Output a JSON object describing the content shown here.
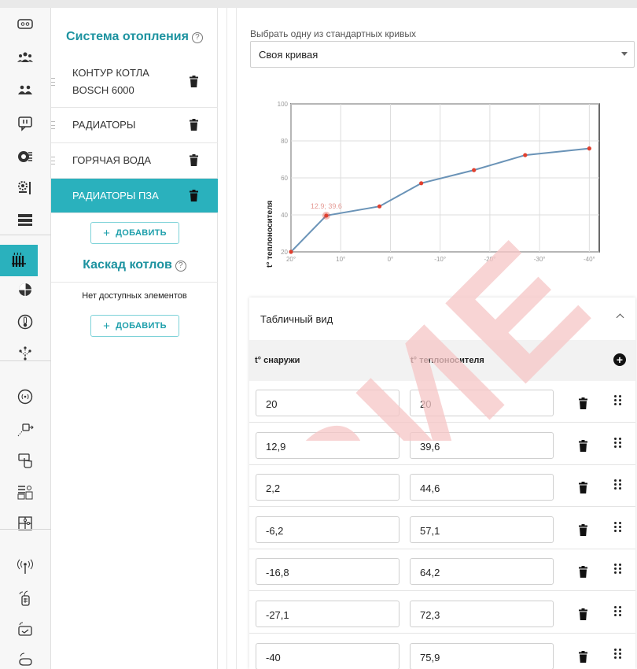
{
  "rail": {
    "icons": [
      "counter-icon",
      "users-group-icon",
      "users-icon",
      "chat-alert-icon",
      "burner-icon",
      "gear-settings-icon",
      "server-icon",
      "radiator-icon",
      "globe-icon",
      "thermometer-icon",
      "network-icon",
      "signal-icon",
      "sensor-icon",
      "touch-icon",
      "panel-icon",
      "puzzle-icon",
      "antenna-icon",
      "tag-icon",
      "remote-icon",
      "hand-icon"
    ]
  },
  "tree": {
    "heating_title": "Система отопления",
    "heating_help": "?",
    "items": [
      {
        "label_line1": "КОНТУР КОТЛА",
        "label_line2": "BOSCH 6000"
      },
      {
        "label_line1": "РАДИАТОРЫ",
        "label_line2": ""
      },
      {
        "label_line1": "ГОРЯЧАЯ ВОДА",
        "label_line2": ""
      },
      {
        "label_line1": "РАДИАТОРЫ ПЗА",
        "label_line2": ""
      }
    ],
    "add_label": "ДОБАВИТЬ",
    "cascade_title": "Каскад котлов",
    "cascade_help": "?",
    "cascade_empty": "Нет доступных элементов",
    "add_label_2": "ДОБАВИТЬ"
  },
  "curve": {
    "select_label": "Выбрать одну из стандартных кривых",
    "select_value": "Своя кривая"
  },
  "chart_data": {
    "type": "line",
    "ylabel": "t° теплоносителя",
    "ylim": [
      20,
      100
    ],
    "xlim": [
      20,
      -42
    ],
    "y_ticks": [
      "20",
      "40",
      "60",
      "80",
      "100"
    ],
    "x_ticks": [
      "20°",
      "10°",
      "0°",
      "-10°",
      "-20°",
      "-30°",
      "-40°"
    ],
    "x_tick_values": [
      20,
      10,
      0,
      -10,
      -20,
      -30,
      -40
    ],
    "y_tick_values": [
      20,
      40,
      60,
      80,
      100
    ],
    "x": [
      20,
      12.9,
      2.2,
      -6.2,
      -16.8,
      -27.1,
      -40
    ],
    "y": [
      20,
      39.6,
      44.6,
      57.1,
      64.2,
      72.3,
      75.9
    ],
    "highlight_label": "12.9; 39.6",
    "highlight_index": 1,
    "line_color": "#6a93b7",
    "point_color": "#e0402f"
  },
  "table": {
    "title": "Табличный вид",
    "col_outside": "t° снаружи",
    "col_carrier": "t° теплоносителя",
    "add_symbol": "+",
    "rows": [
      {
        "outside": "20",
        "carrier": "20"
      },
      {
        "outside": "12,9",
        "carrier": "39,6"
      },
      {
        "outside": "2,2",
        "carrier": "44,6"
      },
      {
        "outside": "-6,2",
        "carrier": "57,1"
      },
      {
        "outside": "-16,8",
        "carrier": "64,2"
      },
      {
        "outside": "-27,1",
        "carrier": "72,3"
      },
      {
        "outside": "-40",
        "carrier": "75,9"
      }
    ]
  },
  "colors": {
    "accent": "#2ab1bd",
    "title": "#1d93a0",
    "watermark": "#f4b9b9"
  }
}
